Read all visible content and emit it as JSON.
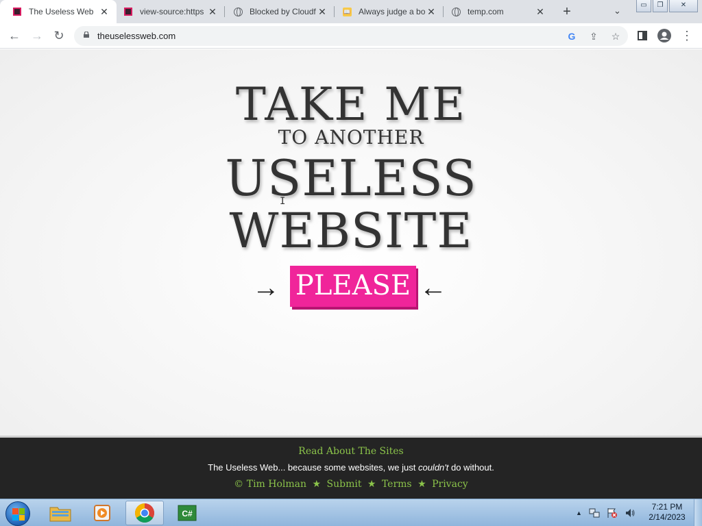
{
  "browser": {
    "tabs": [
      {
        "title": "The Useless Web",
        "favicon": "useless-web-favicon",
        "active": true
      },
      {
        "title": "view-source:https",
        "favicon": "useless-web-favicon",
        "active": false
      },
      {
        "title": "Blocked by Cloudf",
        "favicon": "globe-icon",
        "active": false
      },
      {
        "title": "Always judge a bo",
        "favicon": "book-favicon",
        "active": false
      },
      {
        "title": "temp.com",
        "favicon": "globe-icon",
        "active": false
      }
    ],
    "new_tab_glyph": "+",
    "address": "theuselessweb.com",
    "icons": {
      "back": "←",
      "forward": "→",
      "reload": "↻",
      "google": "G",
      "share": "⇪",
      "star": "☆",
      "menu": "⋮",
      "tabsearch": "⌄",
      "close": "✕",
      "minimize": "▭",
      "maximize": "❐"
    }
  },
  "page": {
    "headline": {
      "line1": "TAKE ME",
      "line2": "TO ANOTHER",
      "line3": "USELESS",
      "line4": "WEBSITE"
    },
    "button": {
      "label": "PLEASE",
      "arrow_left": "→",
      "arrow_right": "←",
      "color": "#f0259a"
    },
    "cursor": "I"
  },
  "footer": {
    "read_link": "Read About The Sites",
    "tagline_prefix": "The Useless Web... because some websites, we just ",
    "tagline_em": "couldn't",
    "tagline_suffix": " do without.",
    "links": [
      "© Tim Holman",
      "Submit",
      "Terms",
      "Privacy"
    ],
    "separator": "★",
    "link_color": "#8bc34a"
  },
  "taskbar": {
    "apps": [
      "windows-explorer",
      "media-player",
      "chrome",
      "csharp-editor"
    ],
    "clock_time": "7:21 PM",
    "clock_date": "2/14/2023",
    "tray_glyphs": {
      "expand": "▲"
    }
  }
}
